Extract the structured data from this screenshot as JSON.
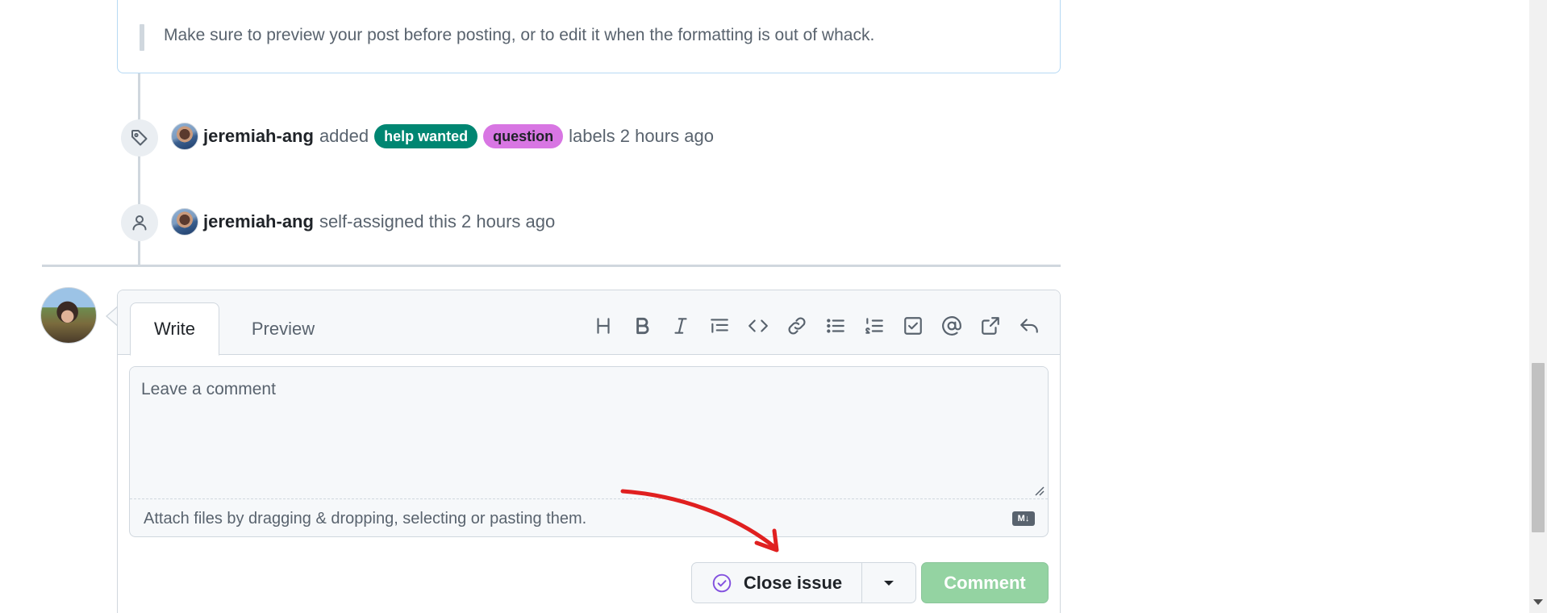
{
  "quote": {
    "text": "Make sure to preview your post before posting, or to edit it when the formatting is out of whack."
  },
  "timeline": {
    "labels_event": {
      "author": "jeremiah-ang",
      "action": "added",
      "labels": [
        {
          "name": "help wanted",
          "color": "#008672"
        },
        {
          "name": "question",
          "color": "#d876e3"
        }
      ],
      "suffix": "labels 2 hours ago",
      "icon": "tag-icon"
    },
    "assign_event": {
      "author": "jeremiah-ang",
      "action": "self-assigned this 2 hours ago",
      "icon": "person-icon"
    }
  },
  "editor": {
    "tabs": {
      "write": "Write",
      "preview": "Preview"
    },
    "toolbar_icons": [
      "heading-icon",
      "bold-icon",
      "italic-icon",
      "quote-icon",
      "code-icon",
      "link-icon",
      "unordered-list-icon",
      "ordered-list-icon",
      "task-list-icon",
      "mention-icon",
      "cross-reference-icon",
      "saved-replies-icon"
    ],
    "placeholder": "Leave a comment",
    "value": "",
    "attach_text": "Attach files by dragging & dropping, selecting or pasting them.",
    "markdown_badge": "M↓"
  },
  "actions": {
    "close_issue": "Close issue",
    "comment": "Comment",
    "comment_color": "#94d3a2",
    "close_icon_color": "#8250df"
  },
  "annotation": {
    "color": "#e02020"
  }
}
